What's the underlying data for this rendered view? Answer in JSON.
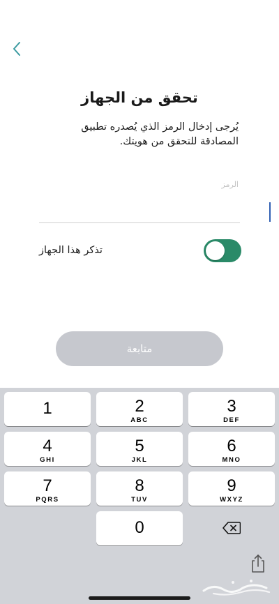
{
  "header": {
    "back_icon": "chevron-left-icon",
    "title": "تحقق من الجهاز",
    "subtitle": "يُرجى إدخال الرمز الذي يُصدره تطبيق المصادقة للتحقق من هويتك."
  },
  "form": {
    "code_label": "الرمز",
    "code_value": "",
    "remember_label": "تذكر هذا الجهاز",
    "remember_on": true,
    "continue_label": "متابعة"
  },
  "keypad": {
    "keys": [
      {
        "digit": "1",
        "letters": ""
      },
      {
        "digit": "2",
        "letters": "ABC"
      },
      {
        "digit": "3",
        "letters": "DEF"
      },
      {
        "digit": "4",
        "letters": "GHI"
      },
      {
        "digit": "5",
        "letters": "JKL"
      },
      {
        "digit": "6",
        "letters": "MNO"
      },
      {
        "digit": "7",
        "letters": "PQRS"
      },
      {
        "digit": "8",
        "letters": "TUV"
      },
      {
        "digit": "9",
        "letters": "WXYZ"
      },
      {
        "digit": "0",
        "letters": ""
      }
    ],
    "delete_icon": "backspace-icon",
    "share_icon": "share-icon"
  },
  "colors": {
    "accent": "#2a8a68",
    "back_chevron": "#3a9aa0",
    "button_disabled": "#c6c8ce",
    "keypad_bg": "#d1d3d8"
  }
}
